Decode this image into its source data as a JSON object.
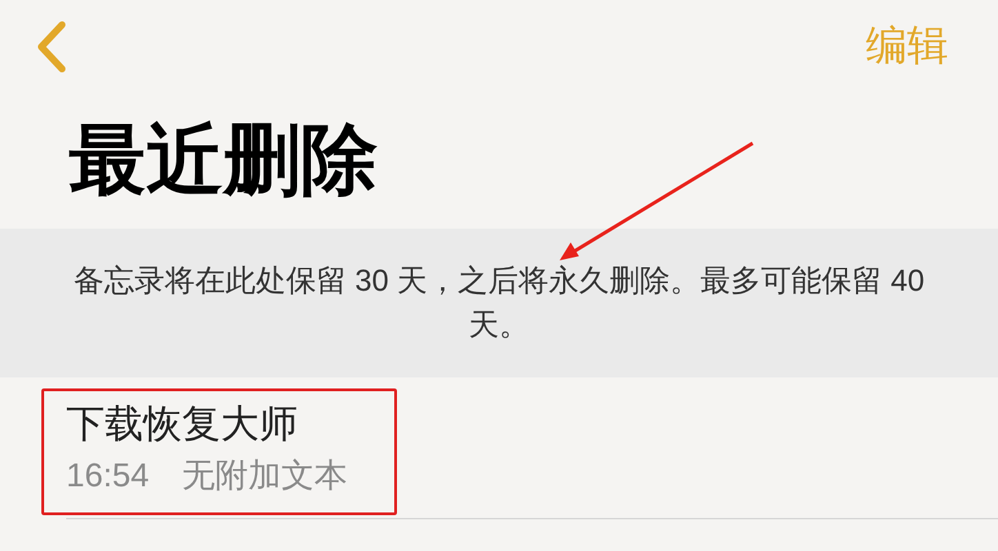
{
  "nav": {
    "edit": "编辑"
  },
  "title": "最近删除",
  "notice": "备忘录将在此处保留 30 天，之后将永久删除。最多可能保留 40 天。",
  "notes": [
    {
      "title": "下载恢复大师",
      "time": "16:54",
      "preview": "无附加文本",
      "highlighted": true
    }
  ]
}
